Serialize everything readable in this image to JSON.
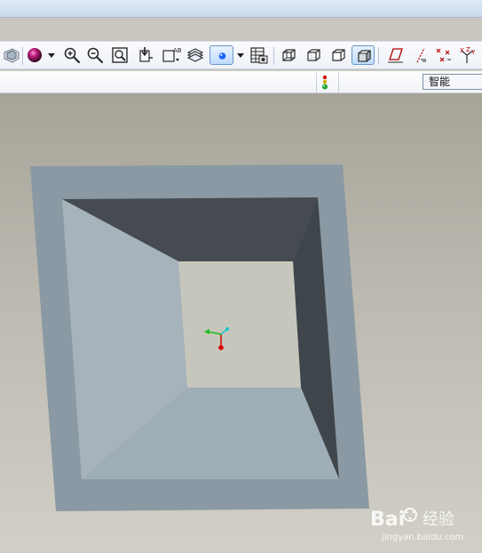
{
  "colors": {
    "titlebar": "#d7e4f5",
    "toolbar_bg": "#f3f6fb",
    "viewport_top": "#a7a498",
    "viewport_bottom": "#d2d0c6",
    "frame_face": "#8a99a3",
    "inner_left": "#a6b3bb",
    "inner_top_dark": "#454b50",
    "inner_right_dark": "#3f464b",
    "inner_bottom": "#9eadb6",
    "opening": "#c7c6bc"
  },
  "toolbar": {
    "buttons": [
      {
        "name": "view-manager-button",
        "icon": "layers-icon",
        "active": false
      },
      {
        "name": "appearance-button",
        "icon": "sphere-icon",
        "active": false
      },
      {
        "name": "appearance-dropdown",
        "icon": "chevron-down-icon",
        "active": false
      },
      {
        "name": "zoom-in-button",
        "icon": "zoom-in-icon",
        "active": false
      },
      {
        "name": "zoom-out-button",
        "icon": "zoom-out-icon",
        "active": false
      },
      {
        "name": "refit-button",
        "icon": "refit-icon",
        "active": false
      },
      {
        "name": "reorient-button",
        "icon": "reorient-icon",
        "active": false
      },
      {
        "name": "saved-views-button",
        "icon": "saved-views-icon",
        "active": false
      },
      {
        "name": "layers-button",
        "icon": "layers-stack-icon",
        "active": false
      },
      {
        "name": "display-style-button",
        "icon": "blue-dot-icon",
        "active": true
      },
      {
        "name": "display-style-dropdown",
        "icon": "chevron-down-icon",
        "active": false
      },
      {
        "name": "properties-button",
        "icon": "table-icon",
        "active": false
      },
      {
        "name": "wireframe-button",
        "icon": "cube-wireframe-icon",
        "active": false
      },
      {
        "name": "hidden-line-button",
        "icon": "cube-hidden-icon",
        "active": false
      },
      {
        "name": "no-hidden-button",
        "icon": "cube-nohidden-icon",
        "active": false
      },
      {
        "name": "shading-button",
        "icon": "cube-shaded-icon",
        "active": true
      },
      {
        "name": "datum-planes-button",
        "icon": "datum-plane-icon",
        "active": false
      },
      {
        "name": "datum-axes-button",
        "icon": "datum-axis-icon",
        "active": false
      },
      {
        "name": "datum-points-button",
        "icon": "datum-points-icon",
        "active": false
      },
      {
        "name": "coordinate-systems-button",
        "icon": "csys-icon",
        "active": false
      }
    ]
  },
  "status": {
    "traffic_light_icon": "traffic-light-icon",
    "filter_value": "智能"
  },
  "watermark": {
    "text_main": "Bai",
    "text_cn": "经验",
    "url": "jingyan.baidu.com"
  }
}
